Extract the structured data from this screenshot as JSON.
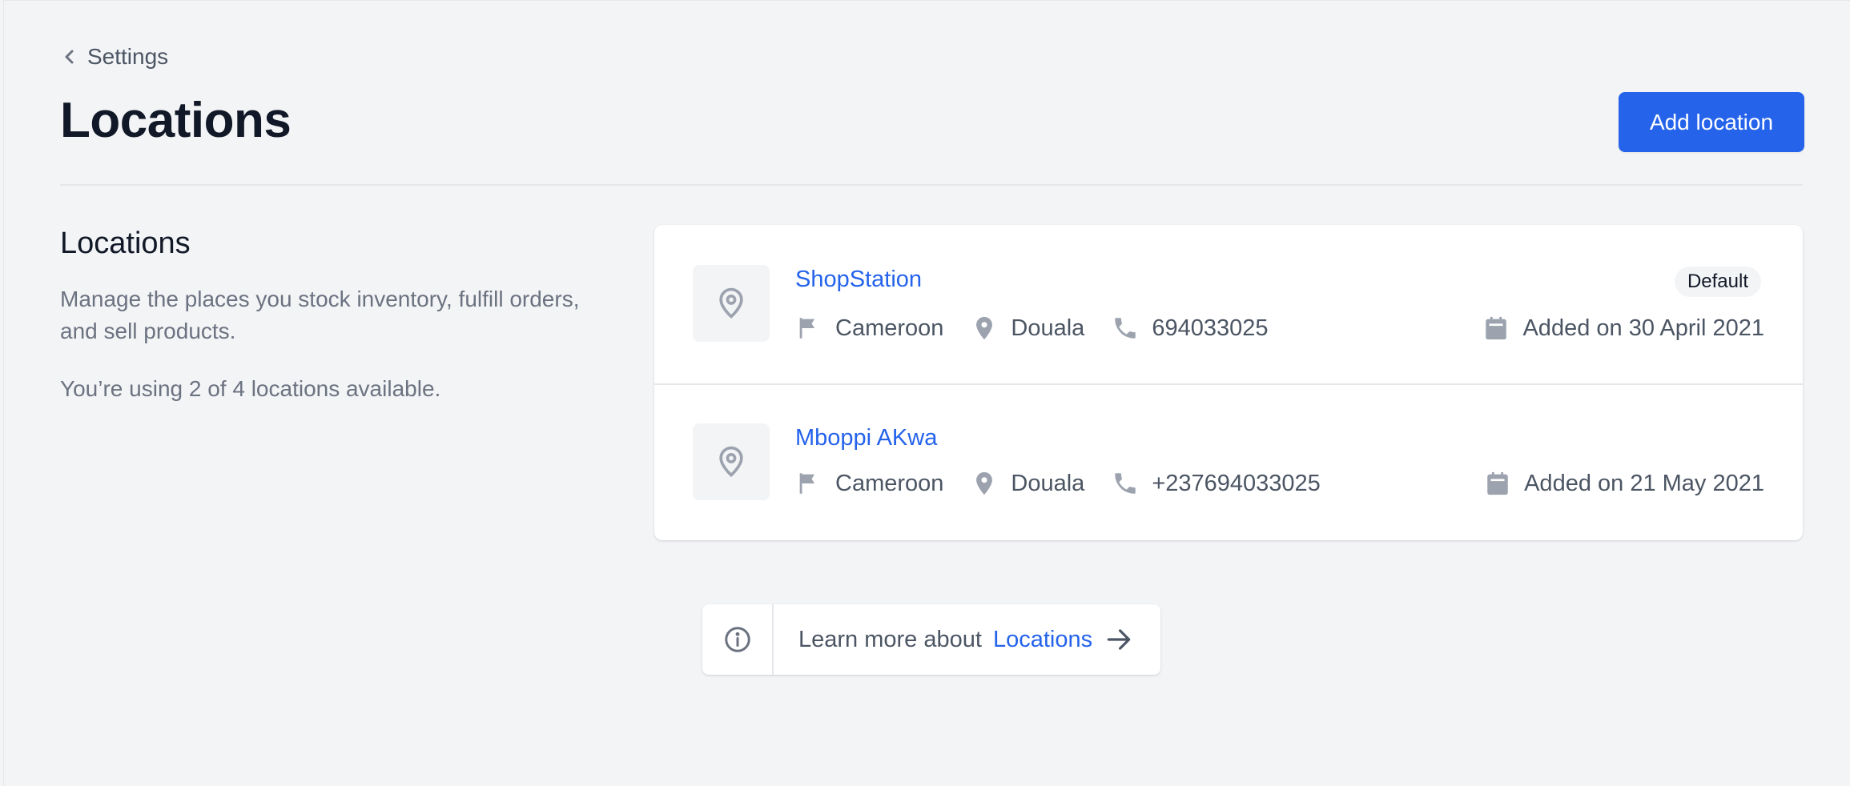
{
  "header": {
    "back_label": "Settings",
    "title": "Locations",
    "add_button_label": "Add location"
  },
  "sidebar": {
    "heading": "Locations",
    "description": "Manage the places you stock inventory, fulfill orders, and sell products.",
    "usage": "You’re using 2 of 4 locations available."
  },
  "locations": [
    {
      "name": "ShopStation",
      "badge": "Default",
      "country": "Cameroon",
      "city": "Douala",
      "phone": "694033025",
      "added": "Added on 30 April 2021"
    },
    {
      "name": "Mboppi AKwa",
      "badge": "",
      "country": "Cameroon",
      "city": "Douala",
      "phone": "+237694033025",
      "added": "Added on 21 May 2021"
    }
  ],
  "learn_more": {
    "text": "Learn more about",
    "link": "Locations"
  },
  "colors": {
    "accent": "#2563eb",
    "background": "#f3f4f6",
    "icon": "#9ca3af"
  },
  "icons": {
    "back": "chevron-left-icon",
    "location": "map-pin-outline-icon",
    "country": "flag-icon",
    "city": "map-pin-icon",
    "phone": "phone-icon",
    "added": "calendar-icon",
    "info": "info-circle-icon",
    "arrow": "arrow-right-icon"
  }
}
